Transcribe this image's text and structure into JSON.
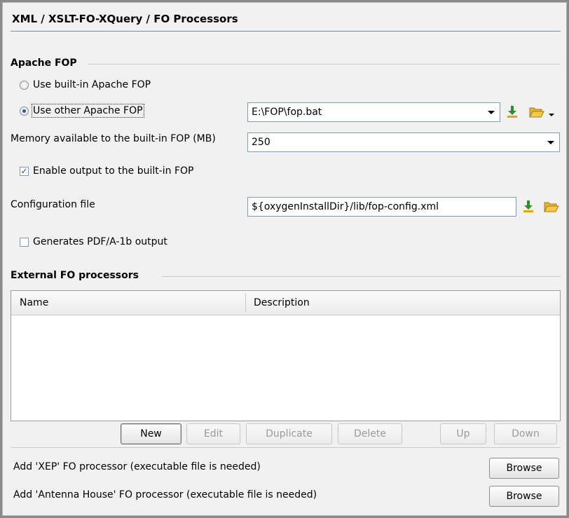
{
  "header": {
    "title": "XML / XSLT-FO-XQuery / FO Processors"
  },
  "apache_fop": {
    "section_title": "Apache FOP",
    "radio_builtin": "Use built-in Apache FOP",
    "radio_other": "Use other Apache FOP",
    "other_path": "E:\\FOP\\fop.bat",
    "memory_label": "Memory available to the built-in FOP (MB)",
    "memory_value": "250",
    "enable_output_label": "Enable output to the built-in FOP",
    "enable_output_checked": true,
    "config_label": "Configuration file",
    "config_value": "${oxygenInstallDir}/lib/fop-config.xml",
    "pdfa_label": "Generates PDF/A-1b output",
    "pdfa_checked": false
  },
  "external": {
    "section_title": "External FO processors",
    "columns": [
      "Name",
      "Description"
    ],
    "rows": [],
    "buttons": {
      "new": "New",
      "edit": "Edit",
      "duplicate": "Duplicate",
      "delete": "Delete",
      "up": "Up",
      "down": "Down"
    },
    "xep_label": "Add 'XEP' FO processor (executable file is needed)",
    "antenna_label": "Add 'Antenna House' FO processor (executable file is needed)",
    "browse_label": "Browse"
  },
  "icons": {
    "download": "download-icon",
    "folder": "folder-open-icon",
    "dropdown": "chevron-down-icon",
    "accent_green": "#2e8b2e",
    "accent_orange": "#e8a300",
    "folder_color": "#f3c84b"
  }
}
